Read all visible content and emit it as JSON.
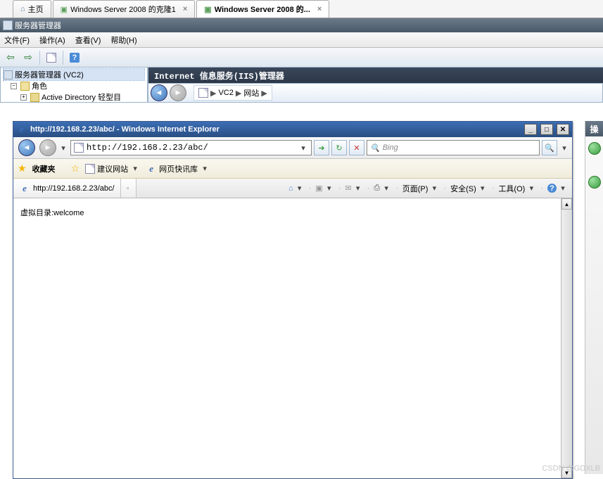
{
  "vm_tabs": {
    "home": "主页",
    "tab1": "Windows Server 2008 的克隆1",
    "tab2": "Windows Server 2008 的..."
  },
  "sm": {
    "title": "服务器管理器",
    "menu": {
      "file": "文件(F)",
      "action": "操作(A)",
      "view": "查看(V)",
      "help": "帮助(H)"
    },
    "tree": {
      "root": "服务器管理器 (VC2)",
      "roles": "角色",
      "ad": "Active Directory 轻型目"
    }
  },
  "iis": {
    "title": "Internet 信息服务(IIS)管理器",
    "bc1": "VC2",
    "bc2": "网站"
  },
  "ie": {
    "title": "http://192.168.2.23/abc/ - Windows Internet Explorer",
    "url": "http://192.168.2.23/abc/",
    "search_placeholder": "Bing",
    "fav_label": "收藏夹",
    "fav_suggest": "建议网站",
    "fav_slice": "网页快讯库",
    "tab_title": "http://192.168.2.23/abc/",
    "tool_page": "页面(P)",
    "tool_safe": "安全(S)",
    "tool_tools": "工具(O)",
    "content": "虚拟目录:welcome"
  },
  "right": {
    "hdr": "操"
  },
  "watermark": "CSDN @GDXLB"
}
